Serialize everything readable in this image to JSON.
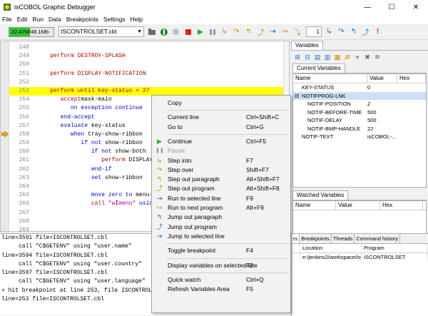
{
  "window": {
    "title": "isCOBOL Graphic Debugger",
    "minimize": "—",
    "maximize": "☐",
    "close": "✕"
  },
  "menu": [
    "File",
    "Edit",
    "Run",
    "Data",
    "Breakpoints",
    "Settings",
    "Help"
  ],
  "toolbar": {
    "memory_text": "22.47M/48.1Mb",
    "memory_fraction": 0.47,
    "program": "ISCONTROLSET.cbl",
    "step_count": "1"
  },
  "code": [
    {
      "num": "248",
      "parts": []
    },
    {
      "num": "249",
      "parts": [
        [
          "kw",
          "    perform DESTROY-SPLASH"
        ]
      ]
    },
    {
      "num": "250",
      "parts": []
    },
    {
      "num": "251",
      "parts": [
        [
          "kw",
          "    perform DISPLAY-NOTIFICATION"
        ]
      ]
    },
    {
      "num": "252",
      "parts": []
    },
    {
      "num": "253",
      "parts": [
        [
          "kw",
          "    perform until key-status = 27"
        ]
      ],
      "hl": true
    },
    {
      "num": "254",
      "parts": [
        [
          "kw",
          "       accept"
        ],
        [
          "",
          "mask-main"
        ]
      ]
    },
    {
      "num": "255",
      "parts": [
        [
          "kw2",
          "          on exception continue"
        ]
      ]
    },
    {
      "num": "256",
      "parts": [
        [
          "kw2",
          "       end-accept"
        ]
      ]
    },
    {
      "num": "257",
      "parts": [
        [
          "kw2",
          "       evaluate"
        ],
        [
          "",
          " key-status"
        ]
      ]
    },
    {
      "num": "258",
      "parts": [
        [
          "kw2",
          "          when"
        ],
        [
          "",
          " tray-show-ribbon"
        ]
      ]
    },
    {
      "num": "259",
      "parts": [
        [
          "kw2",
          "             if not"
        ],
        [
          "",
          " show-ribbon"
        ]
      ]
    },
    {
      "num": "260",
      "parts": [
        [
          "kw2",
          "                if not"
        ],
        [
          "",
          " show-both"
        ]
      ]
    },
    {
      "num": "261",
      "parts": [
        [
          "kw",
          "                   perform"
        ],
        [
          "",
          " DISPLAY-R"
        ]
      ]
    },
    {
      "num": "262",
      "parts": [
        [
          "kw2",
          "                end-if"
        ]
      ]
    },
    {
      "num": "263",
      "parts": [
        [
          "kw2",
          "                set"
        ],
        [
          "",
          " show-ribbon    to"
        ]
      ]
    },
    {
      "num": "264",
      "parts": []
    },
    {
      "num": "265",
      "parts": [
        [
          "kw2",
          "                move zero to"
        ],
        [
          "",
          " menu-h"
        ]
      ]
    },
    {
      "num": "266",
      "parts": [
        [
          "kw",
          "                call"
        ],
        [
          "str",
          " \"w"
        ],
        [
          "",
          "İ"
        ],
        [
          "str",
          "menu\""
        ],
        [
          "kw2",
          " using"
        ]
      ]
    },
    {
      "num": "267",
      "parts": []
    },
    {
      "num": "268",
      "parts": []
    },
    {
      "num": "269",
      "parts": []
    }
  ],
  "variables": {
    "tab": "Variables",
    "current_tab": "Current Variables",
    "columns": [
      "Name",
      "Value",
      "Hex"
    ],
    "rows": [
      {
        "name": "KEY-STATUS",
        "value": "0",
        "indent": 1,
        "tree": ""
      },
      {
        "name": "NOTIFPROG-LNK",
        "value": "",
        "indent": 1,
        "tree": "⊟",
        "selected": true
      },
      {
        "name": "NOTIF-POSITION",
        "value": "2",
        "indent": 2,
        "tree": ""
      },
      {
        "name": "NOTIF-BEFORE-TIME",
        "value": "500",
        "indent": 2,
        "tree": ""
      },
      {
        "name": "NOTIF-DELAY",
        "value": "500",
        "indent": 2,
        "tree": ""
      },
      {
        "name": "NOTIF-BMP-HANDLE",
        "value": "22",
        "indent": 2,
        "tree": ""
      },
      {
        "name": "NOTIF-TEXT",
        "value": "isCOBOL-...",
        "indent": 1,
        "tree": ""
      }
    ],
    "watched_tab": "Watched Variables",
    "watched_columns": [
      "Name",
      "Value",
      "Hex"
    ]
  },
  "console": [
    "line=3591 file=ISCONTROLSET.cbl",
    "     call \"C$GETENV\" using \"user.name\"",
    "line=3594 file=ISCONTROLSET.cbl",
    "     call \"C$GETENV\" using \"user.country\"",
    "line=3597 file=ISCONTROLSET.cbl",
    "     call \"C$GETENV\" using \"user.language\"",
    "+ hit breakpoint at line 253, file ISCONTROLSE",
    "line=253 file=ISCONTROLSET.cbl"
  ],
  "bottom_tabs": [
    "rs",
    "Breakpoints",
    "Threads",
    "Command history"
  ],
  "stack": {
    "columns": [
      "",
      "Location",
      "Program"
    ],
    "rows": [
      [
        "",
        "e:/jenkins2/workspace/isC...",
        "ISCONTROLSET"
      ]
    ]
  },
  "context_menu": [
    {
      "label": "Copy",
      "shortcut": "",
      "icon": "",
      "gap": 0
    },
    {
      "sep": true
    },
    {
      "label": "Current line",
      "shortcut": "Ctrl+Shift+C",
      "icon": ""
    },
    {
      "label": "Go to",
      "shortcut": "Ctrl+G",
      "icon": ""
    },
    {
      "sep": true
    },
    {
      "label": "Continue",
      "shortcut": "Ctrl+F5",
      "icon": "continue-icon"
    },
    {
      "label": "Pause",
      "shortcut": "",
      "icon": "pause-icon",
      "disabled": true
    },
    {
      "label": "Step into",
      "shortcut": "F7",
      "icon": "step-into-icon"
    },
    {
      "label": "Step over",
      "shortcut": "Shift+F7",
      "icon": "step-over-icon"
    },
    {
      "label": "Step out paragraph",
      "shortcut": "Alt+Shift+F7",
      "icon": "step-out-paragraph-icon"
    },
    {
      "label": "Step out program",
      "shortcut": "Alt+Shift+F8",
      "icon": "step-out-program-icon"
    },
    {
      "label": "Run to selected line",
      "shortcut": "F9",
      "icon": "run-to-line-icon"
    },
    {
      "label": "Run to next program",
      "shortcut": "Alt+F9",
      "icon": "run-next-program-icon"
    },
    {
      "label": "Jump out paragraph",
      "shortcut": "",
      "icon": "jump-out-paragraph-icon"
    },
    {
      "label": "Jump out program",
      "shortcut": "",
      "icon": "jump-out-program-icon"
    },
    {
      "label": "Jump to selected line",
      "shortcut": "",
      "icon": "jump-to-line-icon"
    },
    {
      "sep": true
    },
    {
      "label": "Toggle breakpoint",
      "shortcut": "F4",
      "icon": ""
    },
    {
      "sep": true
    },
    {
      "label": "Display variables on selected line",
      "shortcut": "F2",
      "icon": ""
    },
    {
      "sep": true
    },
    {
      "label": "Quick watch",
      "shortcut": "Ctrl+Q",
      "icon": ""
    },
    {
      "label": "Refresh Variables Area",
      "shortcut": "F5",
      "icon": ""
    }
  ],
  "colors": {
    "highlight": "#ffff00",
    "memory_fill": "#31c531",
    "keyword": "#b00000",
    "keyword2": "#0000c8"
  }
}
